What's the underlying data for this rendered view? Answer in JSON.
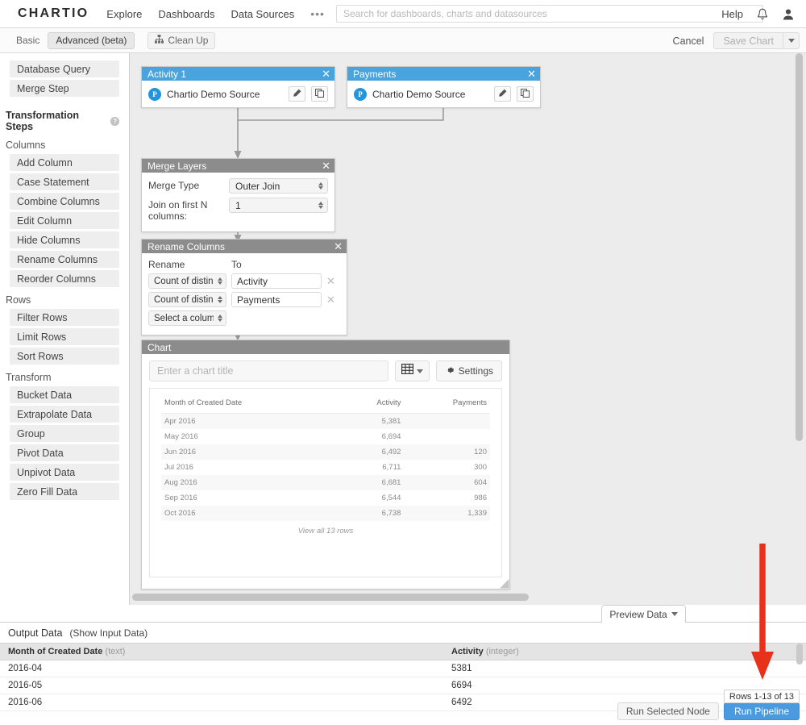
{
  "topnav": {
    "logo": "CHARTIO",
    "links": [
      "Explore",
      "Dashboards",
      "Data Sources"
    ],
    "overflow": "•••",
    "search_placeholder": "Search for dashboards, charts and datasources",
    "search_value": "",
    "help": "Help",
    "bell_icon": "bell-icon",
    "user_icon": "user-icon"
  },
  "toolbar": {
    "tab_basic": "Basic",
    "tab_advanced": "Advanced (beta)",
    "cleanup": "Clean Up",
    "cleanup_icon": "hierarchy-icon",
    "cancel": "Cancel",
    "save": "Save Chart",
    "save_caret_icon": "chevron-down-icon"
  },
  "sidebar": {
    "top_items": [
      "Database Query",
      "Merge Step"
    ],
    "section_title": "Transformation Steps",
    "help_icon": "help-circle-icon",
    "groups": [
      {
        "label": "Columns",
        "items": [
          "Add Column",
          "Case Statement",
          "Combine Columns",
          "Edit Column",
          "Hide Columns",
          "Rename Columns",
          "Reorder Columns"
        ]
      },
      {
        "label": "Rows",
        "items": [
          "Filter Rows",
          "Limit Rows",
          "Sort Rows"
        ]
      },
      {
        "label": "Transform",
        "items": [
          "Bucket Data",
          "Extrapolate Data",
          "Group",
          "Pivot Data",
          "Unpivot Data",
          "Zero Fill Data"
        ]
      }
    ]
  },
  "canvas": {
    "nodes": {
      "activity": {
        "title": "Activity 1",
        "source": "Chartio Demo Source",
        "source_badge": "P",
        "edit_icon": "pencil-icon",
        "copy_icon": "copy-icon",
        "close_icon": "close-icon"
      },
      "payments": {
        "title": "Payments",
        "source": "Chartio Demo Source",
        "source_badge": "P",
        "edit_icon": "pencil-icon",
        "copy_icon": "copy-icon",
        "close_icon": "close-icon"
      },
      "merge": {
        "title": "Merge Layers",
        "close_icon": "close-icon",
        "fields": [
          {
            "label": "Merge Type",
            "value": "Outer Join"
          },
          {
            "label": "Join on first N columns:",
            "value": "1"
          }
        ]
      },
      "rename": {
        "title": "Rename Columns",
        "close_icon": "close-icon",
        "col_from": "Rename",
        "col_to": "To",
        "rows": [
          {
            "from": "Count of distinct .",
            "to": "Activity",
            "remove_icon": "close-icon"
          },
          {
            "from": "Count of distinct",
            "to": "Payments",
            "remove_icon": "close-icon"
          }
        ],
        "empty_row": "Select a column"
      },
      "chart": {
        "title": "Chart",
        "close_icon": "close-icon",
        "title_placeholder": "Enter a chart title",
        "title_value": "",
        "grid_icon": "table-grid-icon",
        "grid_caret_icon": "chevron-down-icon",
        "settings": "Settings",
        "settings_icon": "gear-icon",
        "view_all": "View all 13 rows"
      }
    }
  },
  "chart_data": {
    "type": "table",
    "title": "",
    "columns": [
      "Month of Created Date",
      "Activity",
      "Payments"
    ],
    "rows": [
      [
        "Apr 2016",
        "5,381",
        ""
      ],
      [
        "May 2016",
        "6,694",
        ""
      ],
      [
        "Jun 2016",
        "6,492",
        "120"
      ],
      [
        "Jul 2016",
        "6,711",
        "300"
      ],
      [
        "Aug 2016",
        "6,681",
        "604"
      ],
      [
        "Sep 2016",
        "6,544",
        "986"
      ],
      [
        "Oct 2016",
        "6,738",
        "1,339"
      ]
    ],
    "footer": "View all 13 rows",
    "total_rows": 13
  },
  "preview_tab": {
    "label": "Preview Data",
    "caret_icon": "chevron-down-icon"
  },
  "bottom": {
    "output_label": "Output Data",
    "show_input": "(Show Input Data)",
    "columns": [
      {
        "name": "Month of Created Date",
        "type": "(text)"
      },
      {
        "name": "Activity",
        "type": "(integer)"
      }
    ],
    "rows": [
      [
        "2016-04",
        "5381"
      ],
      [
        "2016-05",
        "6694"
      ],
      [
        "2016-06",
        "6492"
      ]
    ],
    "rows_tooltip": "Rows 1-13 of 13",
    "run_selected": "Run Selected Node",
    "run_pipeline": "Run Pipeline"
  },
  "annotation": {
    "arrow_color": "#e8311a",
    "arrow_icon": "down-arrow-annotation"
  },
  "colors": {
    "node_header_blue": "#49a3dd",
    "node_header_gray": "#8c8c8c",
    "primary_button": "#4a9ae0",
    "source_badge": "#2196dd"
  }
}
